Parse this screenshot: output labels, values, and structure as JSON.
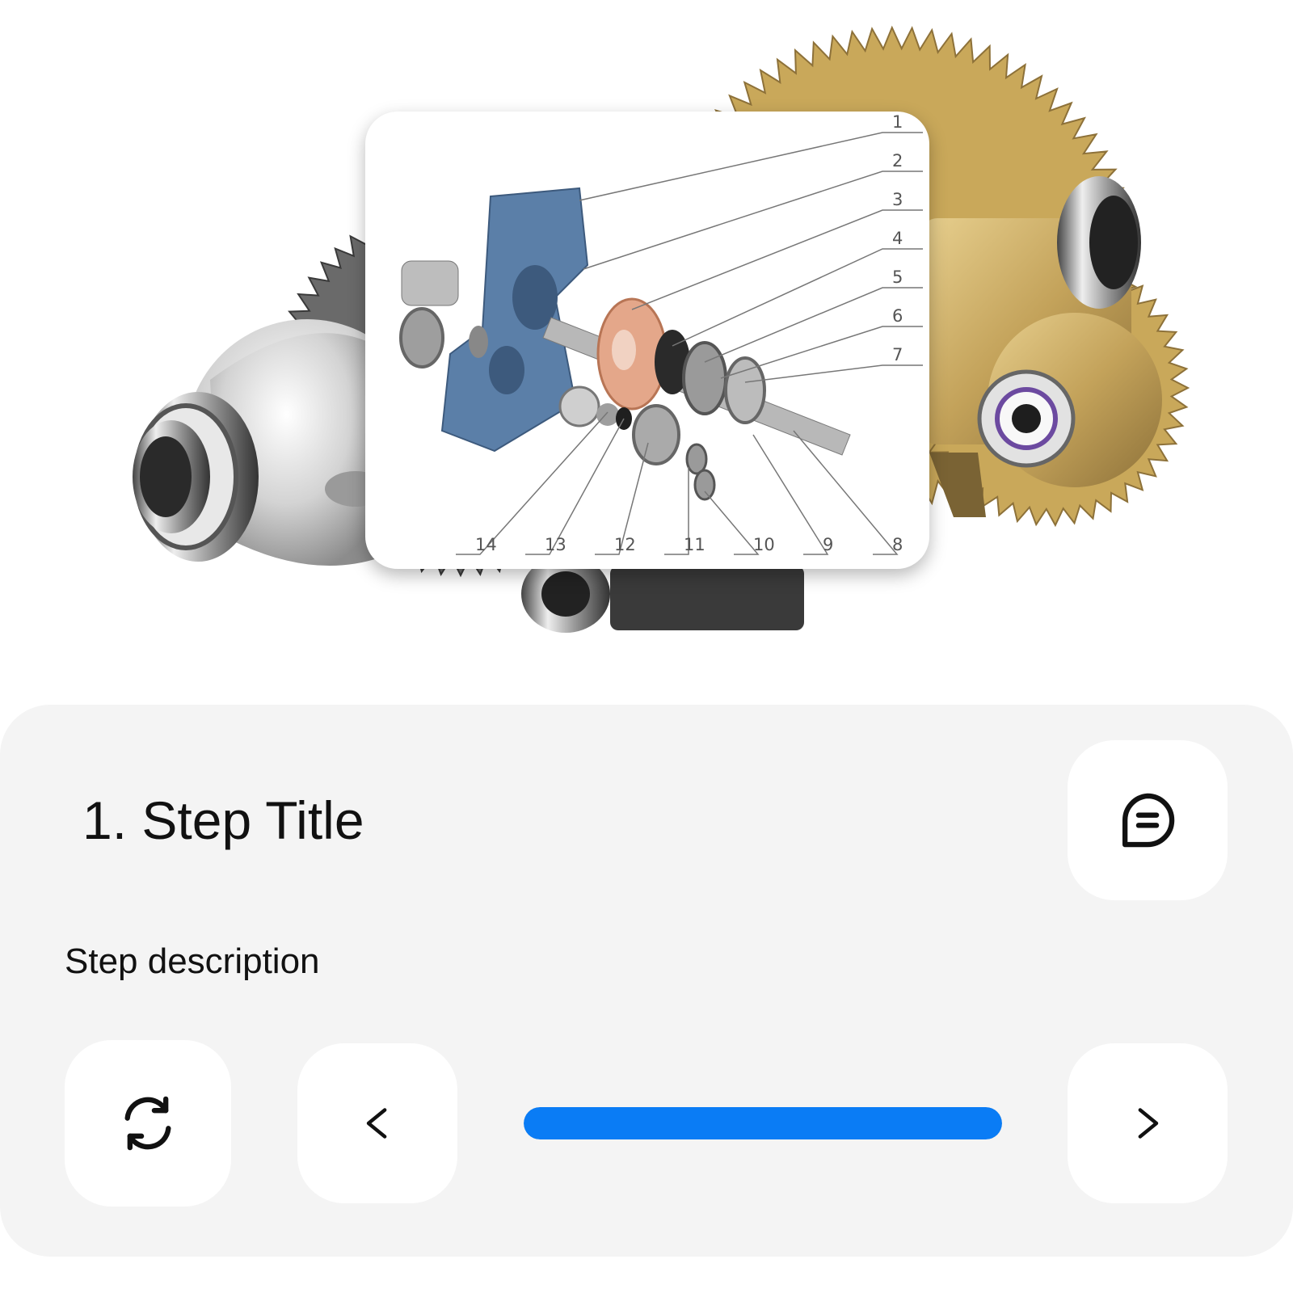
{
  "step": {
    "title": "1. Step Title",
    "description": "Step description",
    "progress": 1.0
  },
  "diagram": {
    "callouts": [
      "1",
      "2",
      "3",
      "4",
      "5",
      "6",
      "7",
      "8",
      "9",
      "10",
      "11",
      "12",
      "13",
      "14"
    ]
  },
  "buttons": {
    "comment_icon": "message-circle-icon",
    "reset_icon": "refresh-icon",
    "prev_icon": "chevron-left-icon",
    "next_icon": "chevron-right-icon"
  },
  "colors": {
    "accent": "#0a7cf5",
    "panel_bg": "#f4f4f4",
    "gear_gold": "#c9a85a",
    "housing_blue": "#5b7fa8"
  }
}
